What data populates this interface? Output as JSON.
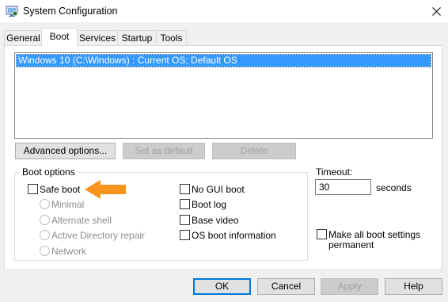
{
  "window": {
    "title": "System Configuration",
    "icon": "system-config-icon",
    "close_glyph": "✕"
  },
  "tabs": [
    {
      "label": "General",
      "active": false
    },
    {
      "label": "Boot",
      "active": true
    },
    {
      "label": "Services",
      "active": false
    },
    {
      "label": "Startup",
      "active": false
    },
    {
      "label": "Tools",
      "active": false
    }
  ],
  "os_list": {
    "entries": [
      "Windows 10 (C:\\Windows) : Current OS; Default OS"
    ],
    "selected_index": 0
  },
  "boot_buttons": {
    "advanced": "Advanced options...",
    "set_default": "Set as default",
    "delete": "Delete"
  },
  "boot_options": {
    "group_label": "Boot options",
    "safe_boot": {
      "label": "Safe boot",
      "checked": false
    },
    "radios": [
      {
        "label": "Minimal",
        "enabled": false
      },
      {
        "label": "Alternate shell",
        "enabled": false
      },
      {
        "label": "Active Directory repair",
        "enabled": false
      },
      {
        "label": "Network",
        "enabled": false
      }
    ],
    "right_checks": [
      {
        "label": "No GUI boot",
        "checked": false
      },
      {
        "label": "Boot log",
        "checked": false
      },
      {
        "label": "Base video",
        "checked": false
      },
      {
        "label": "OS boot information",
        "checked": false
      }
    ]
  },
  "timeout": {
    "label": "Timeout:",
    "value": "30",
    "unit": "seconds"
  },
  "make_permanent": {
    "label_line1": "Make all boot settings",
    "label_line2": "permanent",
    "checked": false
  },
  "dialog_buttons": {
    "ok": "OK",
    "cancel": "Cancel",
    "apply": "Apply",
    "help": "Help"
  },
  "colors": {
    "selection": "#3399ff",
    "annotation_arrow": "#f7941d"
  }
}
